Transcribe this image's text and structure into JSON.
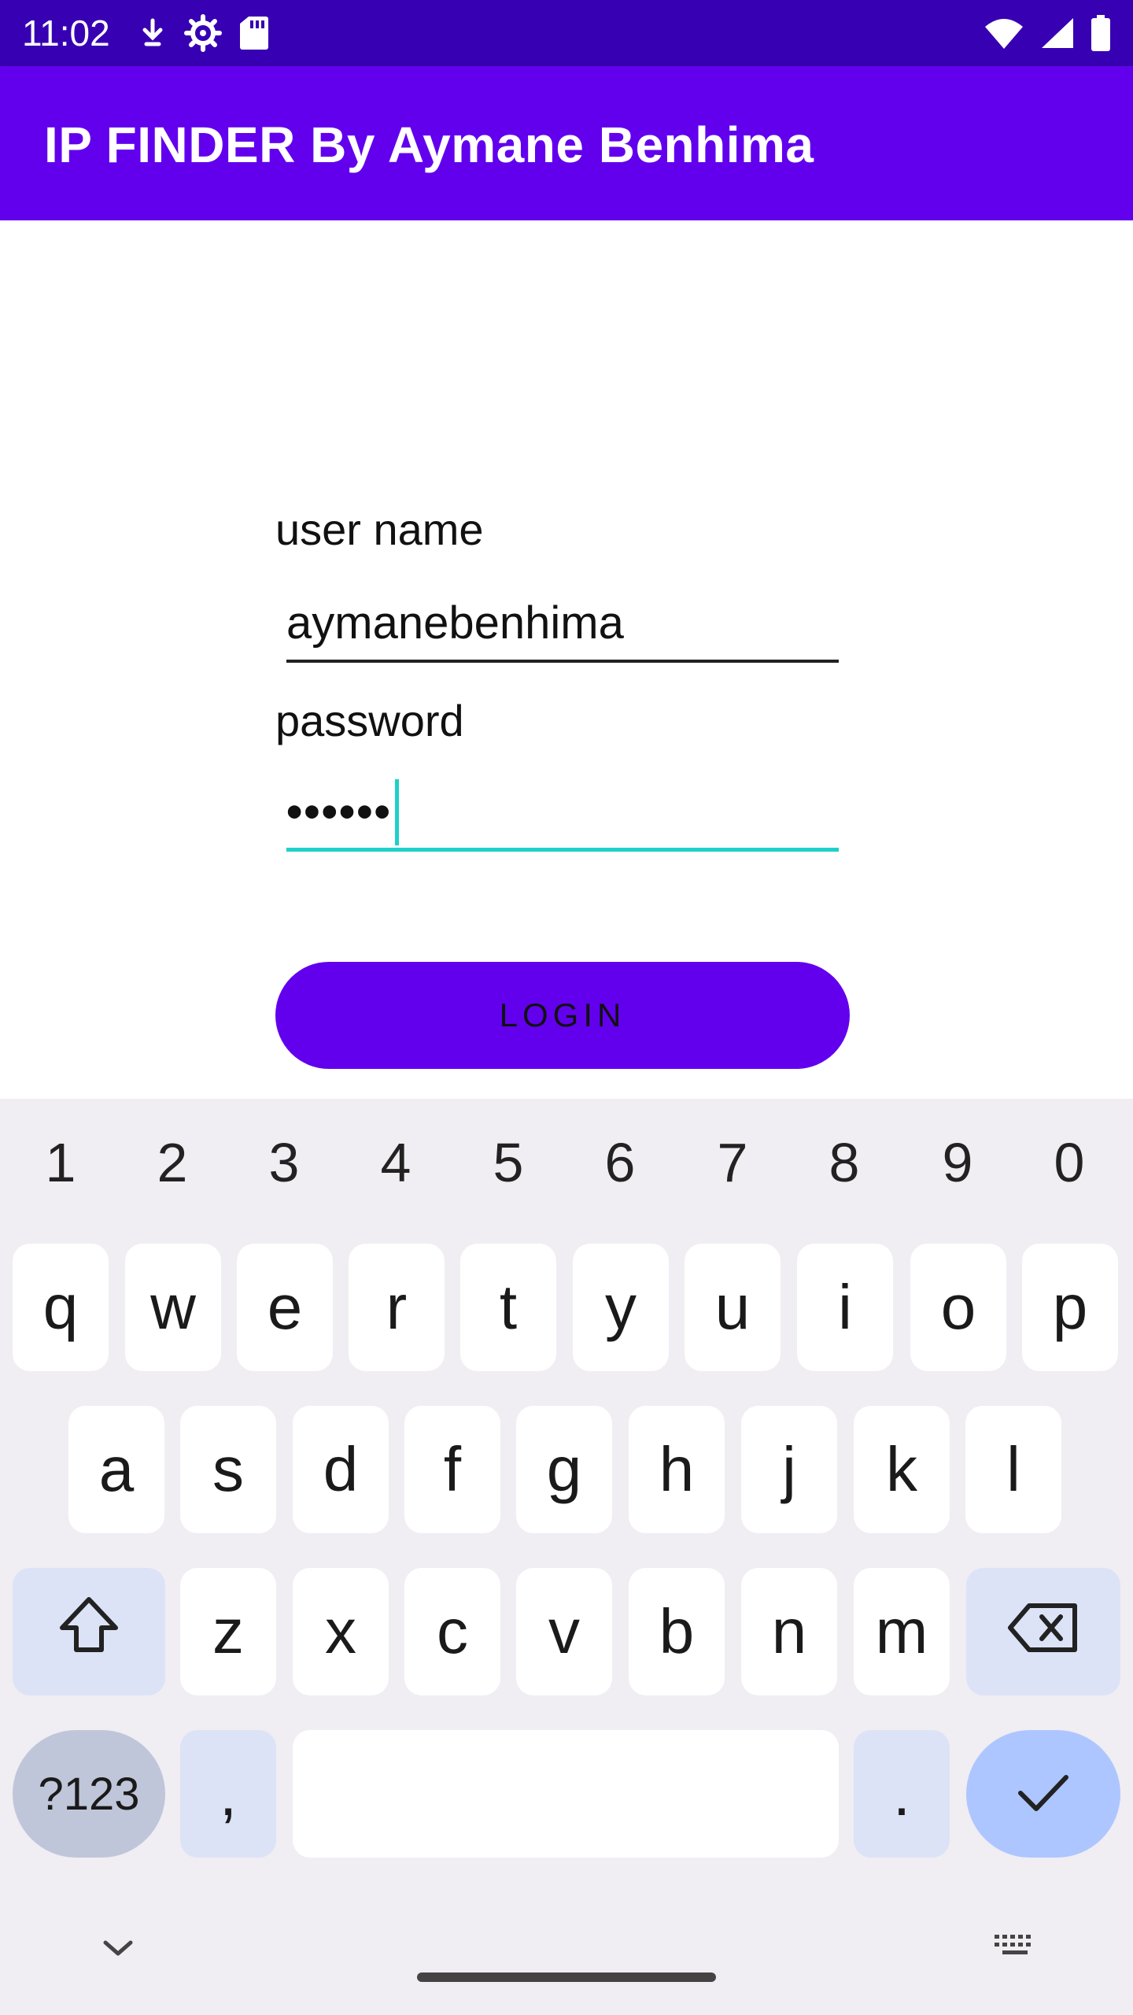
{
  "status_bar": {
    "time": "11:02",
    "left_icons": [
      "download-icon",
      "settings-icon",
      "sd-card-icon"
    ],
    "right_icons": [
      "wifi-icon",
      "signal-icon",
      "battery-icon"
    ],
    "background": "#3700b3"
  },
  "app_bar": {
    "title": "IP FINDER By Aymane Benhima",
    "background": "#6200ee"
  },
  "form": {
    "username_label": "user name",
    "username_value": "aymanebenhima",
    "password_label": "password",
    "password_value": "••••••",
    "login_label": "LOGIN",
    "focus_color": "#1ed1c8"
  },
  "keyboard": {
    "number_row": [
      "1",
      "2",
      "3",
      "4",
      "5",
      "6",
      "7",
      "8",
      "9",
      "0"
    ],
    "row1": [
      "q",
      "w",
      "e",
      "r",
      "t",
      "y",
      "u",
      "i",
      "o",
      "p"
    ],
    "row2": [
      "a",
      "s",
      "d",
      "f",
      "g",
      "h",
      "j",
      "k",
      "l"
    ],
    "row3": [
      "z",
      "x",
      "c",
      "v",
      "b",
      "n",
      "m"
    ],
    "symbols_label": "?123",
    "comma_label": ",",
    "period_label": ".",
    "shift_icon": "shift-icon",
    "backspace_icon": "backspace-icon",
    "done_icon": "check-icon",
    "hide_icon": "chevron-down-icon",
    "switch_icon": "keyboard-icon"
  }
}
